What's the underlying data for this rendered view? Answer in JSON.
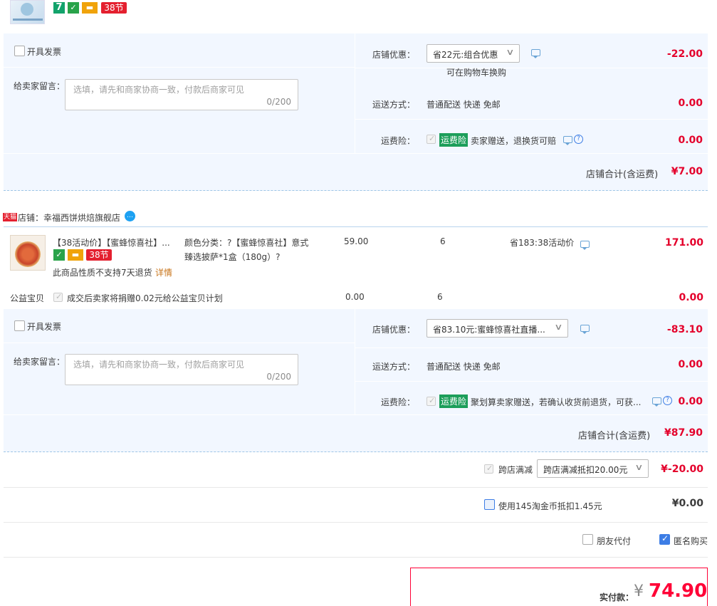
{
  "shop1": {
    "badges": {
      "seven": "7",
      "promo38": "38节"
    },
    "invoice_label": "开具发票",
    "message_label": "给卖家留言：",
    "message_placeholder": "选填，请先和商家协商一致，付款后商家可见",
    "message_count": "0/200",
    "discount_label": "店铺优惠：",
    "discount_option": "省22元:组合优惠",
    "discount_note": "可在购物车换购",
    "discount_amount": "-22.00",
    "shipping_label": "运送方式：",
    "shipping_value": "普通配送 快递 免邮",
    "shipping_amount": "0.00",
    "insurance_label": "运费险：",
    "insurance_tag": "运费险",
    "insurance_text": "卖家赠送，退换货可赔",
    "insurance_amount": "0.00",
    "total_label": "店铺合计(含运费)",
    "total_amount": "¥7.00"
  },
  "shop2": {
    "tmall_tag": "天猫",
    "shop_name": "店铺：幸福西饼烘焙旗舰店",
    "product": {
      "title": "【38活动价】【蜜蜂惊喜社】...",
      "sku_line1": "颜色分类：?【蜜蜂惊喜社】意式",
      "sku_line2": "臻选披萨*1盒（180g）?",
      "price": "59.00",
      "quantity": "6",
      "promo": "省183:38活动价",
      "subtotal": "171.00",
      "promo38": "38节",
      "return_note": "此商品性质不支持7天退货",
      "detail_link": "详情"
    },
    "charity": {
      "label": "公益宝贝",
      "text": "成交后卖家将捐赠0.02元给公益宝贝计划",
      "price": "0.00",
      "quantity": "6",
      "amount": "0.00"
    },
    "invoice_label": "开具发票",
    "message_label": "给卖家留言：",
    "message_placeholder": "选填，请先和商家协商一致，付款后商家可见",
    "message_count": "0/200",
    "discount_label": "店铺优惠：",
    "discount_option": "省83.10元:蜜蜂惊喜社直播...",
    "discount_amount": "-83.10",
    "shipping_label": "运送方式：",
    "shipping_value": "普通配送 快递 免邮",
    "shipping_amount": "0.00",
    "insurance_label": "运费险：",
    "insurance_tag": "运费险",
    "insurance_text": "聚划算卖家赠送，若确认收货前退货，可获...",
    "insurance_amount": "0.00",
    "total_label": "店铺合计(含运费)",
    "total_amount": "¥87.90"
  },
  "cross_store": {
    "label": "跨店满减",
    "option": "跨店满减抵扣20.00元",
    "amount": "¥-20.00"
  },
  "coins": {
    "label": "使用145淘金币抵扣1.45元",
    "amount": "¥0.00"
  },
  "options": {
    "friend_pay": "朋友代付",
    "anonymous": "匿名购买"
  },
  "payment": {
    "label": "实付款：",
    "currency": "¥",
    "amount": "74.90"
  },
  "colors": {
    "accent_red": "#e4002b",
    "panel_bg": "#f2f7ff",
    "checkbox_blue": "#3d7de5",
    "insurance_green": "#1c9e5a"
  }
}
